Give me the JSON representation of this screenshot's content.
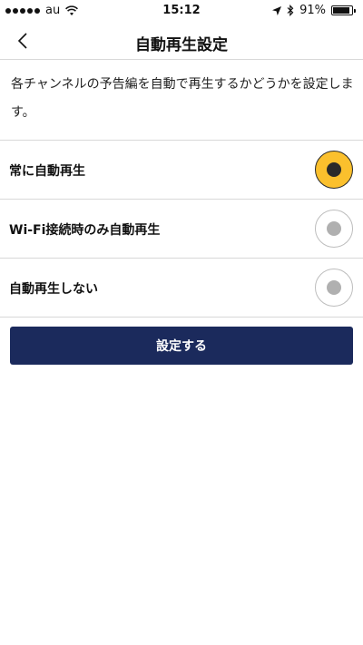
{
  "status_bar": {
    "carrier": "au",
    "time": "15:12",
    "battery_percent": "91%",
    "battery_level": 0.91
  },
  "nav": {
    "title": "自動再生設定"
  },
  "description": "各チャンネルの予告編を自動で再生するかどうかを設定します。",
  "options": [
    {
      "label": "常に自動再生",
      "selected": true
    },
    {
      "label": "Wi-Fi接続時のみ自動再生",
      "selected": false
    },
    {
      "label": "自動再生しない",
      "selected": false
    }
  ],
  "submit_label": "設定する",
  "colors": {
    "accent_yellow": "#fbc02d",
    "button_navy": "#1b2a5c"
  }
}
